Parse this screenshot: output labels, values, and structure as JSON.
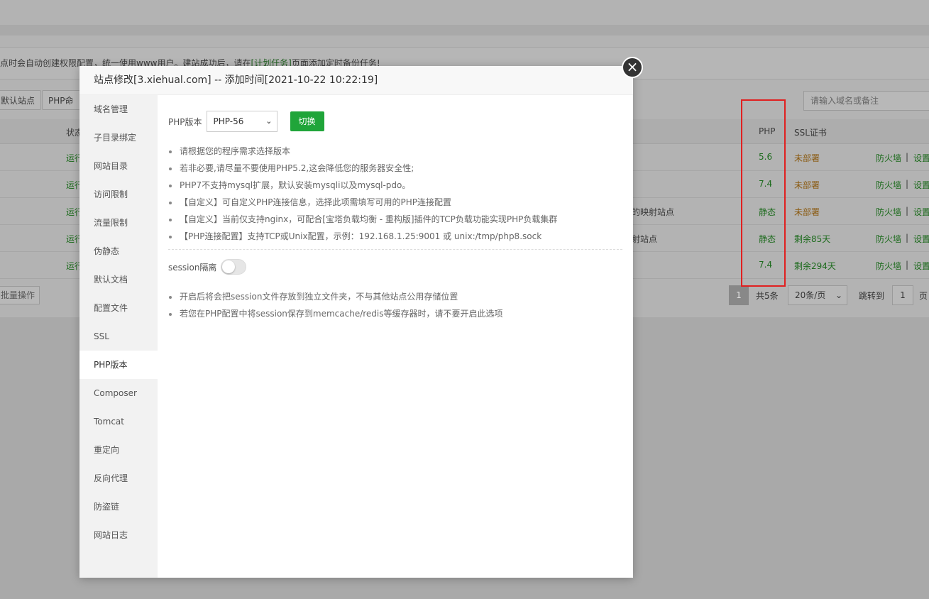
{
  "background": {
    "notice_text": "点时会自动创建权限配置，统一使用www用户。建站成功后，请在",
    "notice_link": "[计划任务]",
    "notice_tail": "页面添加定时备份任务!",
    "buttons": [
      "默认站点",
      "PHP命令"
    ],
    "search_placeholder": "请输入域名或备注",
    "table_headers": {
      "status": "状态",
      "php": "PHP",
      "ssl": "SSL证书"
    },
    "rows": [
      {
        "status": "运行",
        "remark": "",
        "php": "5.6",
        "ssl": "未部署",
        "firewall": "防火墙",
        "settings": "设置"
      },
      {
        "status": "运行",
        "remark": "",
        "php": "7.4",
        "ssl": "未部署",
        "firewall": "防火墙",
        "settings": "设置"
      },
      {
        "status": "运行",
        "remark": "的映射站点",
        "php": "静态",
        "ssl": "未部署",
        "firewall": "防火墙",
        "settings": "设置"
      },
      {
        "status": "运行",
        "remark": "射站点",
        "php": "静态",
        "ssl": "剩余85天",
        "firewall": "防火墙",
        "settings": "设置"
      },
      {
        "status": "运行",
        "remark": "",
        "php": "7.4",
        "ssl": "剩余294天",
        "firewall": "防火墙",
        "settings": "设置"
      }
    ],
    "separator": "|",
    "batch_label": "批量操作",
    "pagination": {
      "current": "1",
      "total": "共5条",
      "per_page": "20条/页",
      "jump_label": "跳转到",
      "jump_value": "1",
      "page_suffix": "页"
    }
  },
  "modal": {
    "title": "站点修改[3.xiehual.com] -- 添加时间[2021-10-22 10:22:19]",
    "close_glyph": "×",
    "sidebar": [
      {
        "label": "域名管理"
      },
      {
        "label": "子目录绑定"
      },
      {
        "label": "网站目录"
      },
      {
        "label": "访问限制"
      },
      {
        "label": "流量限制"
      },
      {
        "label": "伪静态"
      },
      {
        "label": "默认文档"
      },
      {
        "label": "配置文件"
      },
      {
        "label": "SSL"
      },
      {
        "label": "PHP版本"
      },
      {
        "label": "Composer"
      },
      {
        "label": "Tomcat"
      },
      {
        "label": "重定向"
      },
      {
        "label": "反向代理"
      },
      {
        "label": "防盗链"
      },
      {
        "label": "网站日志"
      }
    ],
    "php_label": "PHP版本",
    "php_selected": "PHP-56",
    "switch_button": "切换",
    "tips": [
      "请根据您的程序需求选择版本",
      "若非必要,请尽量不要使用PHP5.2,这会降低您的服务器安全性;",
      "PHP7不支持mysql扩展，默认安装mysqli以及mysql-pdo。",
      "【自定义】可自定义PHP连接信息，选择此项需填写可用的PHP连接配置",
      "【自定义】当前仅支持nginx，可配合[宝塔负载均衡 - 重构版]插件的TCP负载功能实现PHP负载集群",
      "【PHP连接配置】支持TCP或Unix配置，示例：192.168.1.25:9001 或 unix:/tmp/php8.sock"
    ],
    "session_label": "session隔离",
    "session_tips": [
      "开启后将会把session文件存放到独立文件夹，不与其他站点公用存储位置",
      "若您在PHP配置中将session保存到memcache/redis等缓存器时，请不要开启此选项"
    ]
  }
}
